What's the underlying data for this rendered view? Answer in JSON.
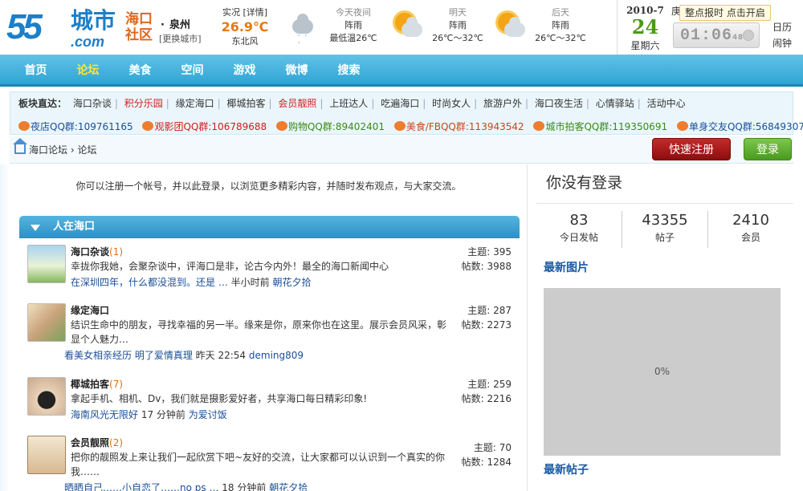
{
  "logo": {
    "num": "55",
    "cn": "城市",
    "com": ".com",
    "sq1": "海口",
    "sq2": "社区"
  },
  "city": {
    "name": "泉州",
    "switch": "[更换城市]"
  },
  "weather": {
    "now": {
      "label": "实况",
      "detail": "[详情]",
      "temp": "26.9℃",
      "wind": "东北风"
    },
    "tonight": {
      "label": "今天夜间",
      "cond": "阵雨",
      "temp": "最低温26℃"
    },
    "tomorrow": {
      "label": "明天",
      "cond": "阵雨",
      "temp": "26℃～32℃"
    },
    "after": {
      "label": "后天",
      "cond": "阵雨",
      "temp": "26℃～32℃"
    }
  },
  "date": {
    "ym": "2010-7",
    "day": "24",
    "weekday": "星期六",
    "lunar": "庚"
  },
  "clock": {
    "hm": "01:06",
    "sec": "48",
    "tip": "整点报时 点击开启"
  },
  "side_links": [
    "日历",
    "闹钟"
  ],
  "nav": {
    "items": [
      "首页",
      "论坛",
      "美食",
      "空间",
      "游戏",
      "微博",
      "搜索"
    ],
    "active": 1
  },
  "quick": {
    "label": "板块直达：",
    "items": [
      {
        "t": "海口杂谈",
        "red": false
      },
      {
        "t": "积分乐园",
        "red": true
      },
      {
        "t": "缘定海口",
        "red": false
      },
      {
        "t": "椰城拍客",
        "red": false
      },
      {
        "t": "会员靓照",
        "red": true
      },
      {
        "t": "上班达人",
        "red": false
      },
      {
        "t": "吃遍海口",
        "red": false
      },
      {
        "t": "时尚女人",
        "red": false
      },
      {
        "t": "旅游户外",
        "red": false
      },
      {
        "t": "海口夜生活",
        "red": false
      },
      {
        "t": "心情驿站",
        "red": false
      },
      {
        "t": "活动中心",
        "red": false
      }
    ],
    "qq": [
      {
        "t": "夜店QQ群:109761165",
        "c": "#1a4e98"
      },
      {
        "t": "观影团QQ群:106789688",
        "c": "#d21b1b"
      },
      {
        "t": "购物QQ群:89402401",
        "c": "#3a8a14"
      },
      {
        "t": "美食/FBQQ群:113943542",
        "c": "#c8461b"
      },
      {
        "t": "城市拍客QQ群:119350691",
        "c": "#3a8a14"
      },
      {
        "t": "单身交友QQ群:56849307",
        "c": "#1a4e98"
      }
    ]
  },
  "crumb": {
    "home": "海口论坛",
    "sep": "›",
    "current": "论坛"
  },
  "buttons": {
    "register": "快速注册",
    "login": "登录"
  },
  "intro": "你可以注册一个帐号，并以此登录，以浏览更多精彩内容，并随时发布观点，与大家交流。",
  "section": "人在海口",
  "forums": [
    {
      "name": "海口杂谈",
      "new": "(1)",
      "desc": "幸拢你我她，会聚杂谈中，评海口是非，论古今内外！最全的海口新闻中心",
      "last": "在深圳四年，什么都没混到。还是 …",
      "time": "半小时前",
      "user": "朝花夕拾",
      "topics": "主题: 395",
      "posts": "帖数: 3988"
    },
    {
      "name": "缘定海口",
      "new": "",
      "desc": "结识生命中的朋友，寻找幸福的另一半。缘来是你，原来你也在这里。展示会员风采，彰显个人魅力…",
      "last": "看美女相亲经历 明了爱情真理",
      "time": "昨天 22:54",
      "user": "deming809",
      "topics": "主题: 287",
      "posts": "帖数: 2273"
    },
    {
      "name": "椰城拍客",
      "new": "(7)",
      "desc": "拿起手机、相机、Dv，我们就是摄影爱好者，共享海口每日精彩印象!",
      "last": "海南风光无限好",
      "time": "17 分钟前",
      "user": "为爱讨饭",
      "topics": "主题: 259",
      "posts": "帖数: 2216"
    },
    {
      "name": "会员靓照",
      "new": "(2)",
      "desc": "把你的靓照发上来让我们一起欣赏下吧~友好的交流，让大家都可以认识到一个真实的你我……",
      "last": "晒晒自己……小自恋了……no ps …",
      "time": "18 分钟前",
      "user": "朝花夕拾",
      "topics": "主题: 70",
      "posts": "帖数: 1284"
    }
  ],
  "sidebar": {
    "not_logged": "你没有登录",
    "stats": [
      {
        "v": "83",
        "l": "今日发帖"
      },
      {
        "v": "43355",
        "l": "帖子"
      },
      {
        "v": "2410",
        "l": "会员"
      }
    ],
    "new_pics": "最新图片",
    "progress": "0%",
    "new_posts": "最新帖子"
  }
}
